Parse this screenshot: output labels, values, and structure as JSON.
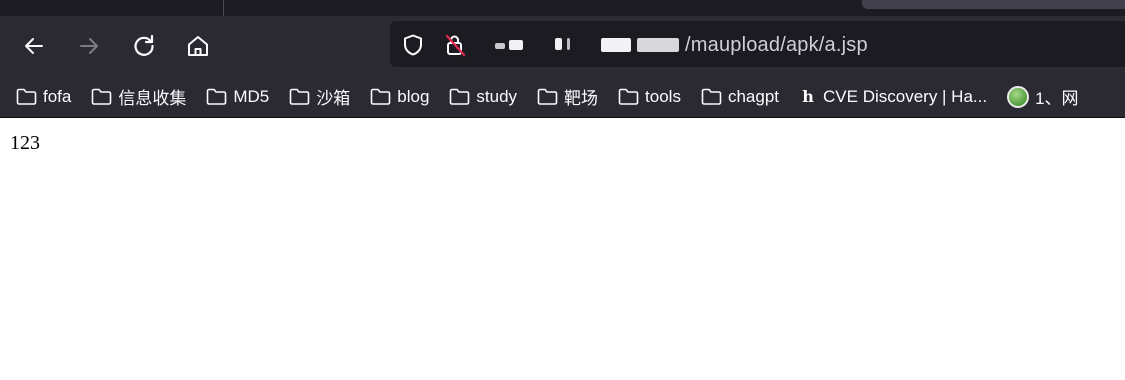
{
  "browser": {
    "url_tail": "/maupload/apk/a.jsp",
    "url_redacted": true
  },
  "bookmarks": [
    {
      "label": "fofa",
      "icon": "folder-icon"
    },
    {
      "label": "信息收集",
      "icon": "folder-icon"
    },
    {
      "label": "MD5",
      "icon": "folder-icon"
    },
    {
      "label": "沙箱",
      "icon": "folder-icon"
    },
    {
      "label": "blog",
      "icon": "folder-icon"
    },
    {
      "label": "study",
      "icon": "folder-icon"
    },
    {
      "label": "靶场",
      "icon": "folder-icon"
    },
    {
      "label": "tools",
      "icon": "folder-icon"
    },
    {
      "label": "chagpt",
      "icon": "folder-icon"
    },
    {
      "label": "CVE Discovery | Ha...",
      "icon": "h1-icon"
    },
    {
      "label": "1、网",
      "icon": "site-icon"
    }
  ],
  "page": {
    "body_text": "123"
  },
  "colors": {
    "toolbar_bg": "#2b2a33",
    "urlbar_bg": "#1c1b22",
    "url_text": "#cfcfd8",
    "icon": "#fbfbfe"
  }
}
